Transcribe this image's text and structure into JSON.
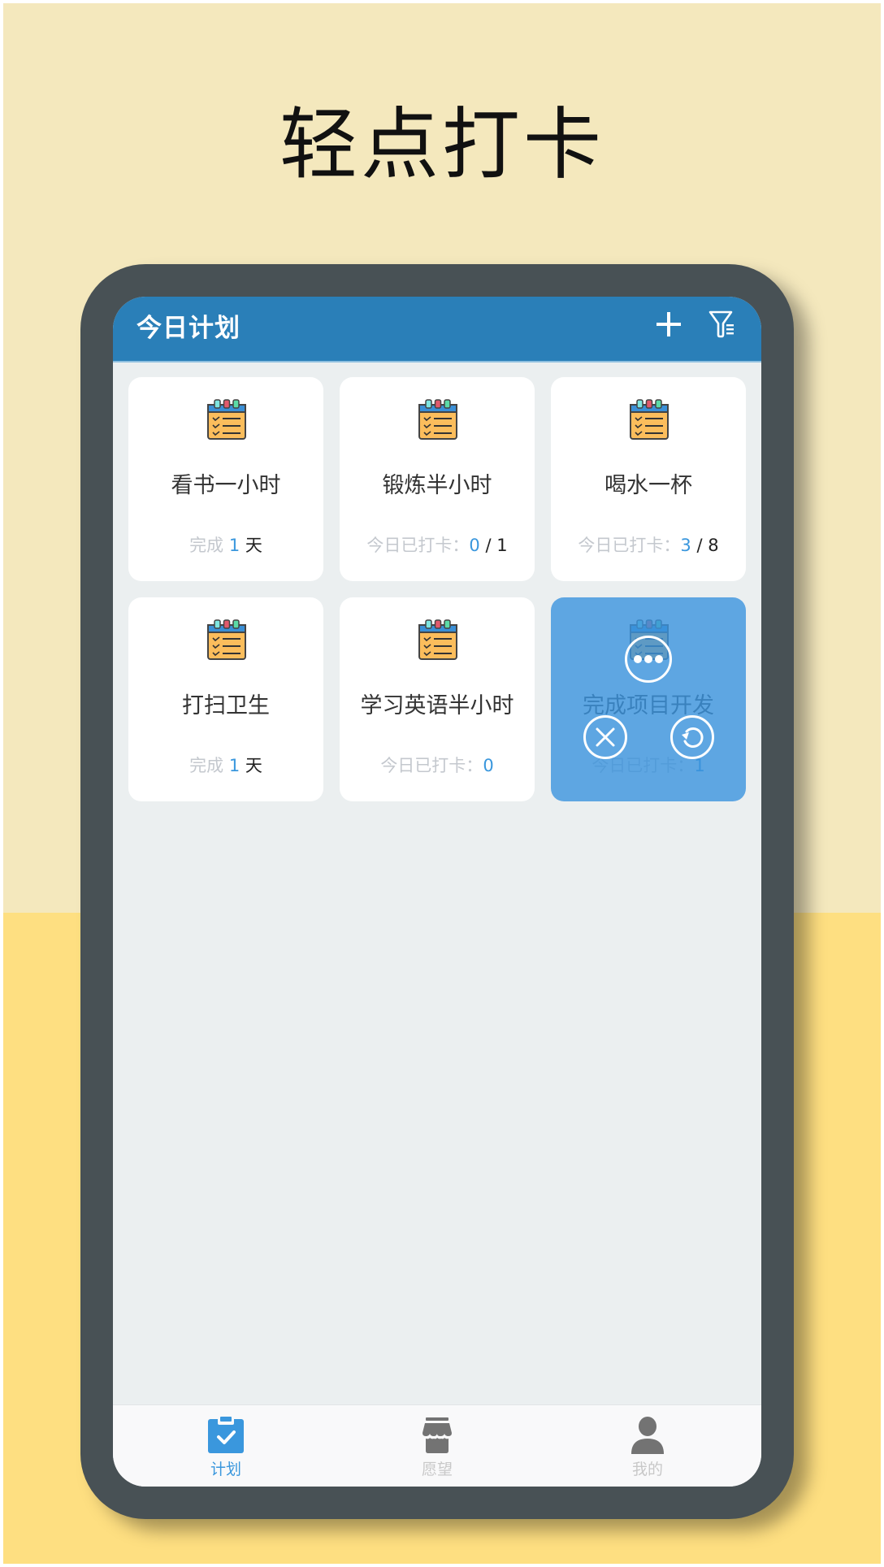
{
  "promo": {
    "title": "轻点打卡"
  },
  "colors": {
    "accent": "#2a7fb8",
    "highlight": "#3a97dd",
    "overlay": "#5aaae0",
    "frame": "#485155",
    "bg_top": "#f4e8bd",
    "bg_bottom": "#fedf81"
  },
  "header": {
    "title": "今日计划",
    "add_icon": "plus-icon",
    "filter_icon": "filter-icon"
  },
  "plans": [
    {
      "title": "看书一小时",
      "icon": "checklist-notepad-icon",
      "status_type": "days",
      "status_prefix": "完成",
      "count": "1",
      "suffix": "天"
    },
    {
      "title": "锻炼半小时",
      "icon": "checklist-notepad-icon",
      "status_type": "ratio",
      "status_prefix": "今日已打卡：",
      "count": "0",
      "suffix": "/ 1"
    },
    {
      "title": "喝水一杯",
      "icon": "checklist-notepad-icon",
      "status_type": "ratio",
      "status_prefix": "今日已打卡：",
      "count": "3",
      "suffix": "/ 8"
    },
    {
      "title": "打扫卫生",
      "icon": "checklist-notepad-icon",
      "status_type": "days",
      "status_prefix": "完成",
      "count": "1",
      "suffix": "天"
    },
    {
      "title": "学习英语半小时",
      "icon": "checklist-notepad-icon",
      "status_type": "count",
      "status_prefix": "今日已打卡：",
      "count": "0",
      "suffix": ""
    },
    {
      "title": "完成项目开发",
      "icon": "checklist-notepad-icon",
      "status_type": "count",
      "status_prefix": "今日已打卡：",
      "count": "1",
      "suffix": "",
      "overlay_actions": [
        "more-icon",
        "close-icon",
        "undo-icon"
      ]
    }
  ],
  "tabbar": {
    "items": [
      {
        "label": "计划",
        "icon": "clipboard-check-icon",
        "active": true
      },
      {
        "label": "愿望",
        "icon": "store-icon",
        "active": false
      },
      {
        "label": "我的",
        "icon": "user-icon",
        "active": false
      }
    ]
  }
}
